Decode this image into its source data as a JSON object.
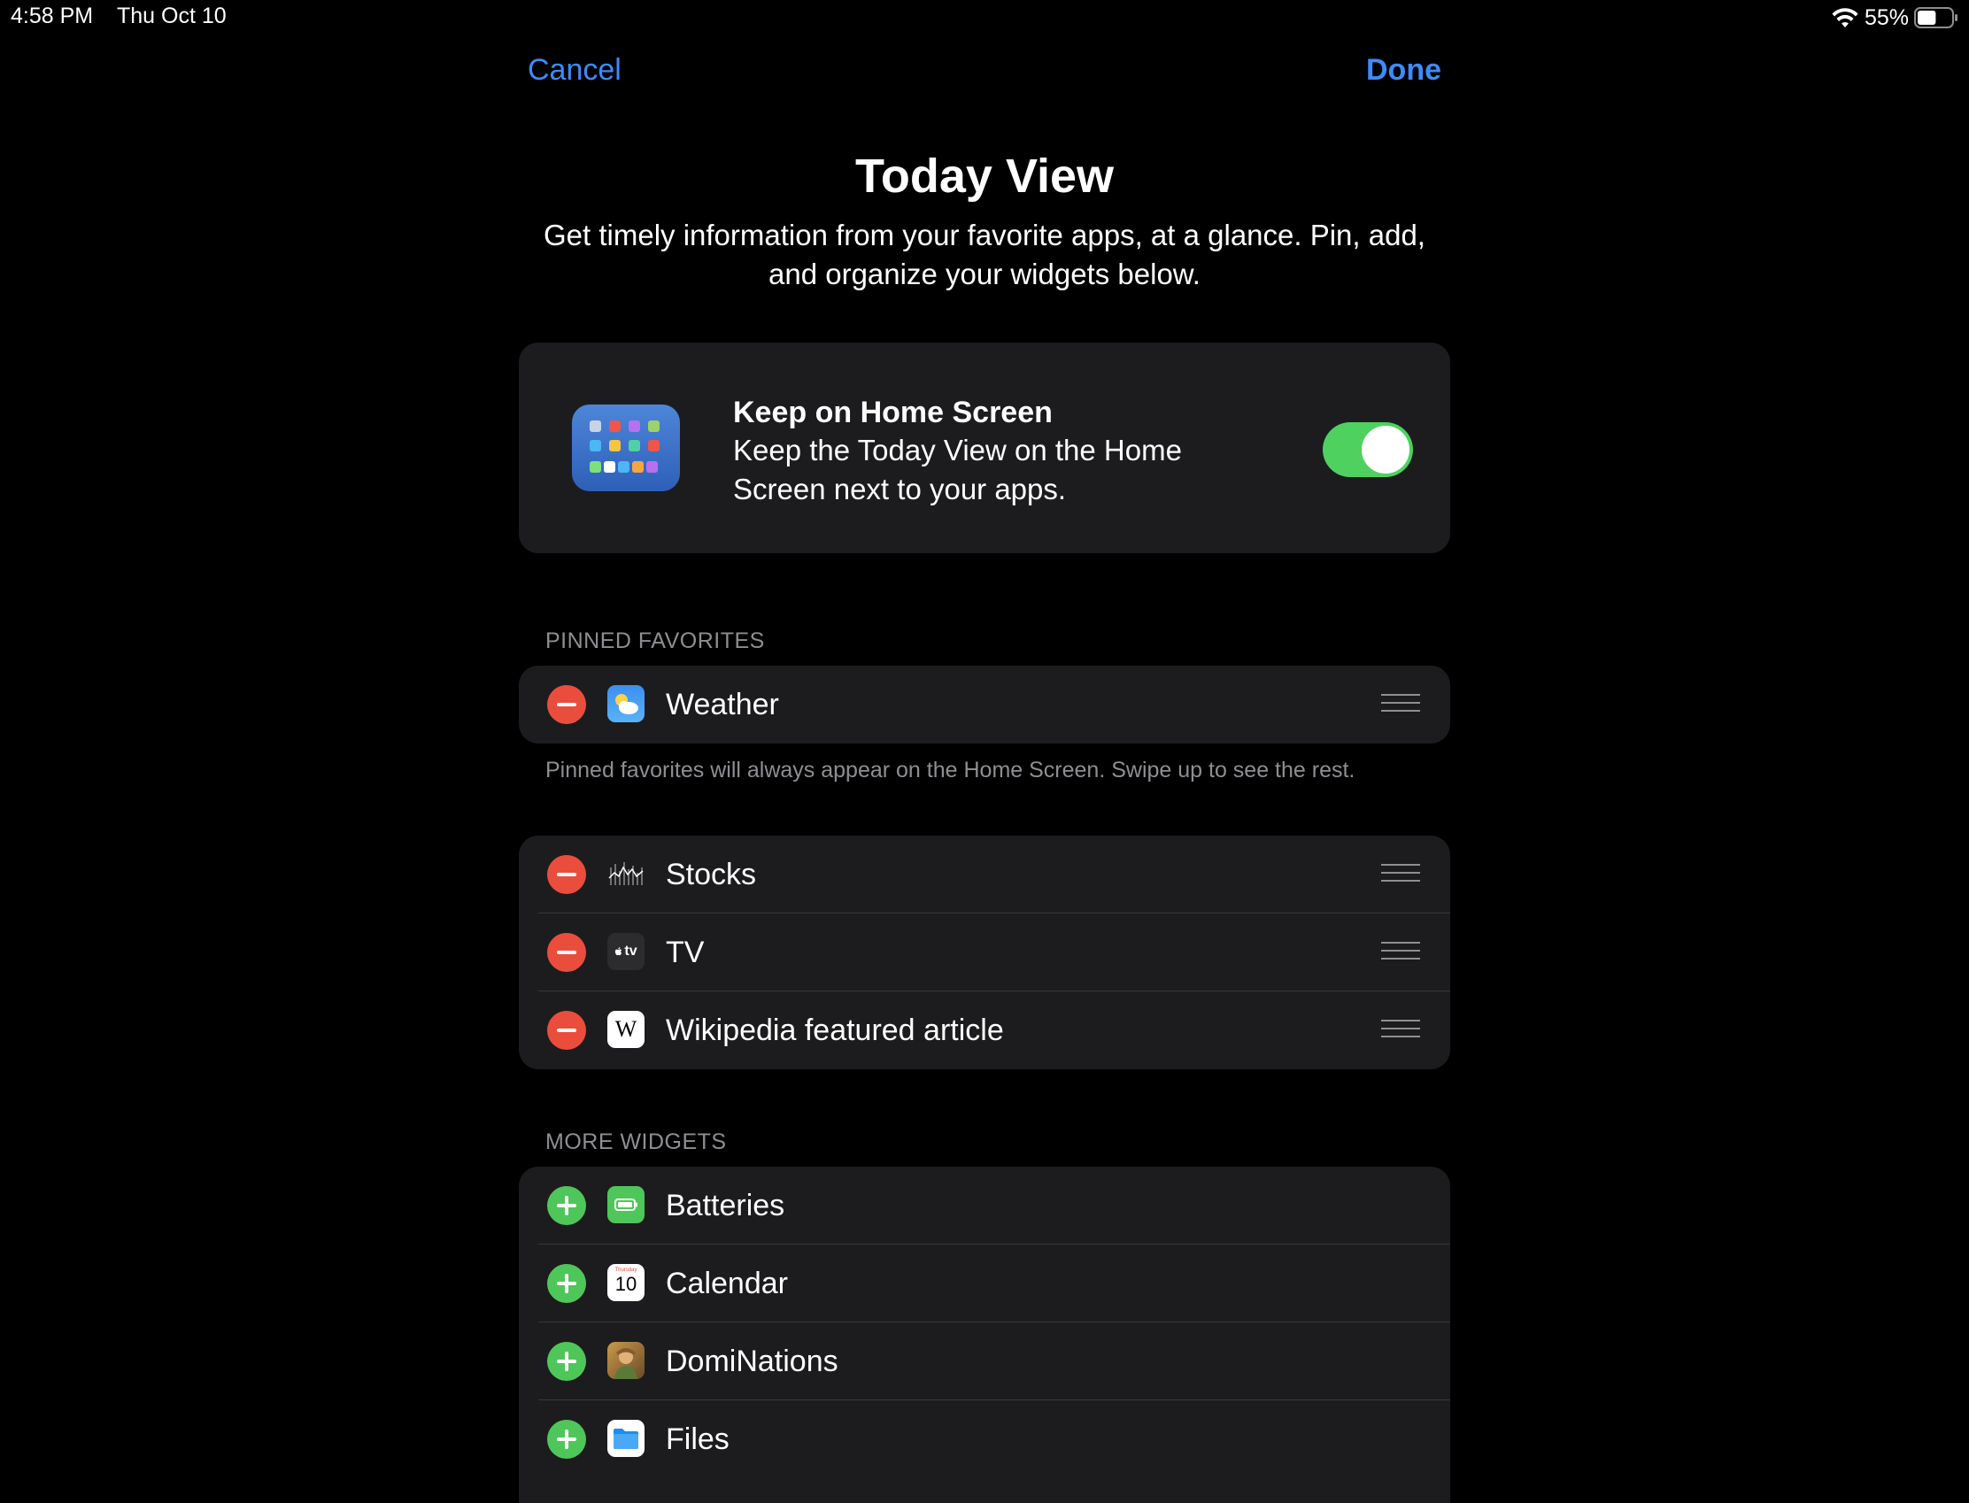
{
  "status_bar": {
    "time": "4:58 PM",
    "date": "Thu Oct 10",
    "battery": "55%",
    "battery_level": 0.55
  },
  "nav": {
    "cancel_label": "Cancel",
    "done_label": "Done"
  },
  "header": {
    "title": "Today View",
    "subtitle": "Get timely information from your favorite apps, at a glance. Pin, add, and organize your widgets below."
  },
  "home_screen": {
    "title": "Keep on Home Screen",
    "description": "Keep the Today View on the Home Screen next to your apps.",
    "toggle_on": true
  },
  "pinned": {
    "header": "PINNED FAVORITES",
    "footer": "Pinned favorites will always appear on the Home Screen. Swipe up to see the rest.",
    "items": [
      {
        "label": "Weather",
        "icon": "weather-icon"
      }
    ]
  },
  "active_widgets": {
    "items": [
      {
        "label": "Stocks",
        "icon": "stocks-icon"
      },
      {
        "label": "TV",
        "icon": "tv-icon",
        "icon_text": "tv"
      },
      {
        "label": "Wikipedia featured article",
        "icon": "wikipedia-icon",
        "icon_text": "W"
      }
    ]
  },
  "more_widgets": {
    "header": "MORE WIDGETS",
    "items": [
      {
        "label": "Batteries",
        "icon": "batteries-icon"
      },
      {
        "label": "Calendar",
        "icon": "calendar-icon",
        "icon_text": "10",
        "icon_subtext": "Thursday"
      },
      {
        "label": "DomiNations",
        "icon": "dominations-icon"
      },
      {
        "label": "Files",
        "icon": "files-icon"
      }
    ]
  },
  "colors": {
    "accent": "#3d8bfd",
    "remove": "#eb4d3d",
    "add": "#4fc659",
    "toggle_on": "#4fd15f",
    "card_bg": "#1c1c1e"
  }
}
